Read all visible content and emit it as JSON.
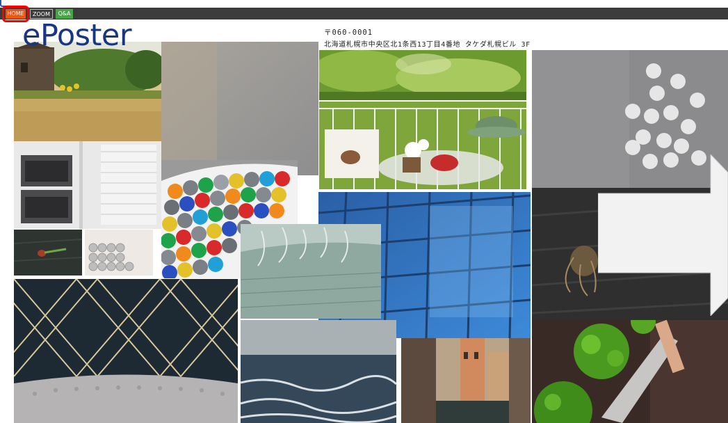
{
  "nav": {
    "home_label": "HOME",
    "zoom_label": "ZOOM",
    "qa_label": "Q&A"
  },
  "poster": {
    "title": "ePoster",
    "postal_code": "〒060-0001",
    "address": "北海道札幌市中央区北1条西13丁目4番地 タケダ札幌ビル 3F"
  },
  "colors": {
    "brand_title": "#1b3680",
    "nav_bar": "#3c3c3c",
    "home_button": "#e8561a",
    "qa_button": "#47a447",
    "highlight": "#ff0000"
  },
  "icons": {
    "next_page": "right-arrow-icon"
  }
}
